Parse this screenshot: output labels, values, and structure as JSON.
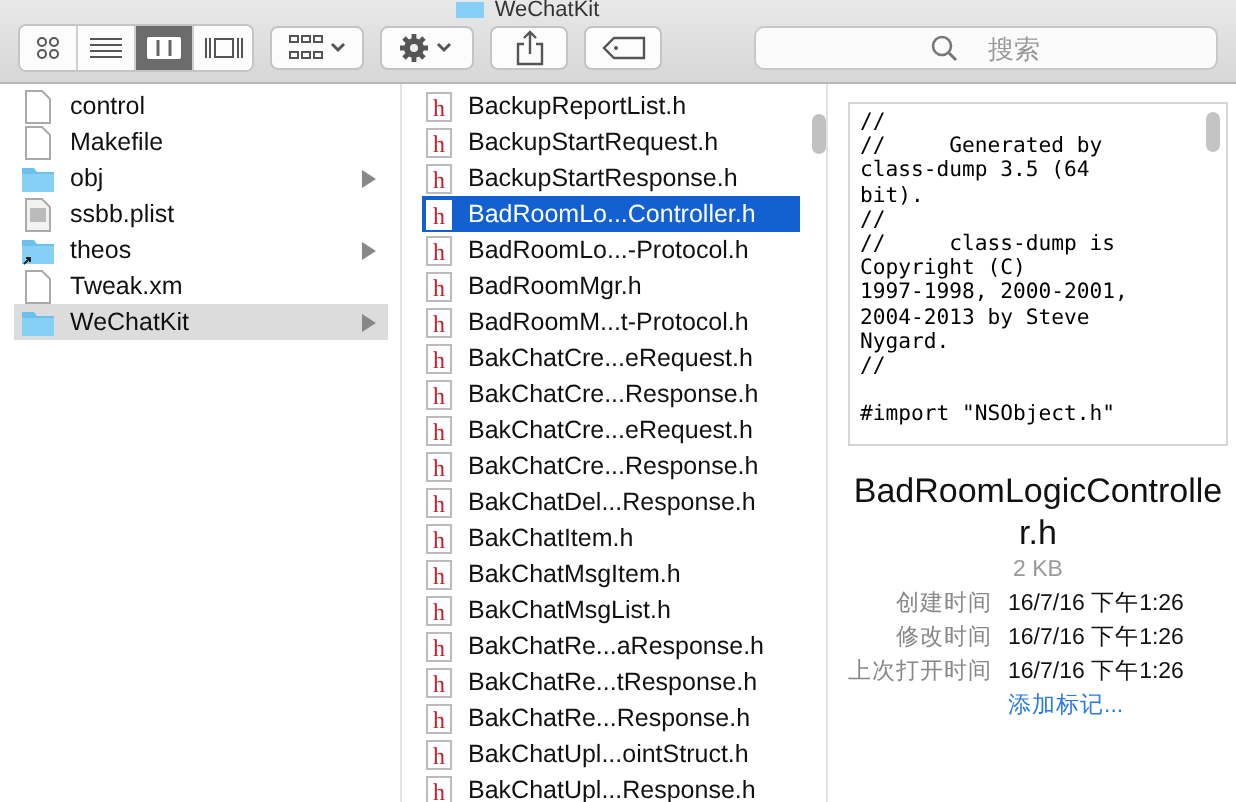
{
  "window": {
    "title": "WeChatKit"
  },
  "toolbar": {
    "view_modes": [
      {
        "kind": "icons",
        "selected": false
      },
      {
        "kind": "list",
        "selected": false
      },
      {
        "kind": "columns",
        "selected": true
      },
      {
        "kind": "coverflow",
        "selected": false
      }
    ],
    "search": {
      "placeholder": "搜索"
    }
  },
  "column_1": {
    "items": [
      {
        "name": "control",
        "kind": "file",
        "selected": false
      },
      {
        "name": "Makefile",
        "kind": "file",
        "selected": false
      },
      {
        "name": "obj",
        "kind": "folder",
        "selected": false
      },
      {
        "name": "ssbb.plist",
        "kind": "plist",
        "selected": false
      },
      {
        "name": "theos",
        "kind": "alias",
        "selected": false
      },
      {
        "name": "Tweak.xm",
        "kind": "file",
        "selected": false
      },
      {
        "name": "WeChatKit",
        "kind": "folder",
        "selected": true
      }
    ]
  },
  "column_2": {
    "items": [
      {
        "name": "BackupReportList.h",
        "icon_text": "h",
        "selected": false
      },
      {
        "name": "BackupStartRequest.h",
        "icon_text": "h",
        "selected": false
      },
      {
        "name": "BackupStartResponse.h",
        "icon_text": "h",
        "selected": false
      },
      {
        "name": "BadRoomLo...Controller.h",
        "icon_text": "h",
        "selected": true
      },
      {
        "name": "BadRoomLo...-Protocol.h",
        "icon_text": "h",
        "selected": false
      },
      {
        "name": "BadRoomMgr.h",
        "icon_text": "h",
        "selected": false
      },
      {
        "name": "BadRoomM...t-Protocol.h",
        "icon_text": "h",
        "selected": false
      },
      {
        "name": "BakChatCre...eRequest.h",
        "icon_text": "h",
        "selected": false
      },
      {
        "name": "BakChatCre...Response.h",
        "icon_text": "h",
        "selected": false
      },
      {
        "name": "BakChatCre...eRequest.h",
        "icon_text": "h",
        "selected": false
      },
      {
        "name": "BakChatCre...Response.h",
        "icon_text": "h",
        "selected": false
      },
      {
        "name": "BakChatDel...Response.h",
        "icon_text": "h",
        "selected": false
      },
      {
        "name": "BakChatItem.h",
        "icon_text": "h",
        "selected": false
      },
      {
        "name": "BakChatMsgItem.h",
        "icon_text": "h",
        "selected": false
      },
      {
        "name": "BakChatMsgList.h",
        "icon_text": "h",
        "selected": false
      },
      {
        "name": "BakChatRe...aResponse.h",
        "icon_text": "h",
        "selected": false
      },
      {
        "name": "BakChatRe...tResponse.h",
        "icon_text": "h",
        "selected": false
      },
      {
        "name": "BakChatRe...Response.h",
        "icon_text": "h",
        "selected": false
      },
      {
        "name": "BakChatUpl...ointStruct.h",
        "icon_text": "h",
        "selected": false
      },
      {
        "name": "BakChatUpl...Response.h",
        "icon_text": "h",
        "selected": false
      }
    ]
  },
  "preview": {
    "code": "//\n//     Generated by\nclass-dump 3.5 (64\nbit).\n//\n//     class-dump is\nCopyright (C)\n1997-1998, 2000-2001,\n2004-2013 by Steve\nNygard.\n//\n\n#import \"NSObject.h\"",
    "file_name": "BadRoomLogicController.h",
    "size": "2 KB",
    "info": [
      {
        "label": "创建时间",
        "value": "16/7/16 下午1:26"
      },
      {
        "label": "修改时间",
        "value": "16/7/16 下午1:26"
      },
      {
        "label": "上次打开时间",
        "value": "16/7/16 下午1:26"
      }
    ],
    "add_tags": "添加标记..."
  }
}
